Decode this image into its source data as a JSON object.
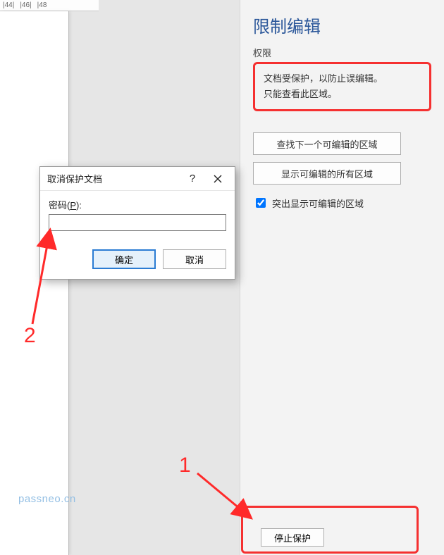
{
  "ruler": {
    "marks": [
      "|44|",
      "|46|",
      "|48"
    ]
  },
  "pane": {
    "title": "限制编辑",
    "subheading": "权限",
    "info_line1": "文档受保护，以防止误编辑。",
    "info_line2": "只能查看此区域。",
    "btn_find_next": "查找下一个可编辑的区域",
    "btn_show_all": "显示可编辑的所有区域",
    "chk_label": "突出显示可编辑的区域",
    "chk_checked": true,
    "btn_stop": "停止保护"
  },
  "dialog": {
    "title": "取消保护文档",
    "help": "?",
    "label_prefix": "密码(",
    "label_u": "P",
    "label_suffix": "):",
    "value": "",
    "ok": "确定",
    "cancel": "取消"
  },
  "annotations": {
    "num1": "1",
    "num2": "2"
  },
  "watermark": "passneo.cn"
}
